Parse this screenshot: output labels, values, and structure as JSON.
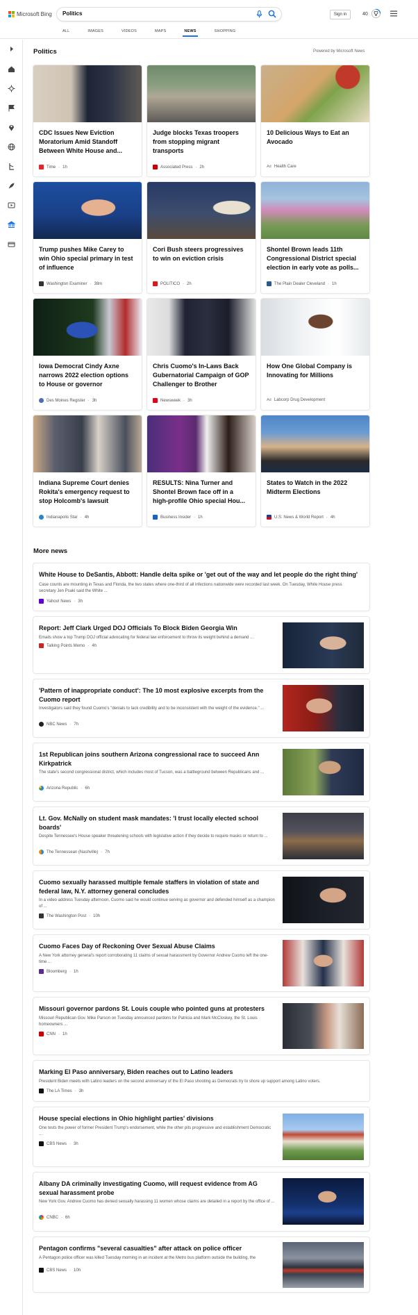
{
  "header": {
    "logo": "Microsoft Bing",
    "query": "Politics",
    "signin": "Sign in",
    "points": "40",
    "tabs": [
      "ALL",
      "IMAGES",
      "VIDEOS",
      "MAPS",
      "NEWS",
      "SHOPPING"
    ],
    "active_tab": "NEWS"
  },
  "colors": {
    "accent": "#1a73e8",
    "logo_red": "#f25022",
    "logo_green": "#7fba00",
    "logo_blue": "#00a4ef",
    "logo_yellow": "#ffb900"
  },
  "main": {
    "title": "Politics",
    "powered": "Powered by Microsoft News",
    "cards": [
      {
        "title": "CDC Issues New Eviction Moratorium Amid Standoff Between White House and...",
        "source": "Time",
        "time": "1h"
      },
      {
        "title": "Judge blocks Texas troopers from stopping migrant transports",
        "source": "Associated Press",
        "time": "2h"
      },
      {
        "title": "10 Delicious Ways to Eat an Avocado",
        "source": "Health Care",
        "time": "",
        "ad": "Ad"
      },
      {
        "title": "Trump pushes Mike Carey to win Ohio special primary in test of influence",
        "source": "Washington Examiner",
        "time": "38m"
      },
      {
        "title": "Cori Bush steers progressives to win on eviction crisis",
        "source": "POLITICO",
        "time": "2h"
      },
      {
        "title": "Shontel Brown leads 11th Congressional District special election in early vote as polls...",
        "source": "The Plain Dealer Cleveland",
        "time": "1h"
      },
      {
        "title": "Iowa Democrat Cindy Axne narrows 2022 election options to House or governor",
        "source": "Des Moines Register",
        "time": "3h"
      },
      {
        "title": "Chris Cuomo's In-Laws Back Gubernatorial Campaign of GOP Challenger to Brother",
        "source": "Newsweek",
        "time": "3h"
      },
      {
        "title": "How One Global Company is Innovating for Millions",
        "source": "Labcorp Drug Development",
        "time": "",
        "ad": "Ad"
      },
      {
        "title": "Indiana Supreme Court denies Rokita's emergency request to stop Holcomb's lawsuit",
        "source": "Indianapolis Star",
        "time": "4h"
      },
      {
        "title": "RESULTS: Nina Turner and Shontel Brown face off in a high-profile Ohio special Hou...",
        "source": "Business Insider",
        "time": "1h"
      },
      {
        "title": "States to Watch in the 2022 Midterm Elections",
        "source": "U.S. News & World Report",
        "time": "4h"
      }
    ],
    "more_title": "More news",
    "news": [
      {
        "title": "White House to DeSantis, Abbott: Handle delta spike or 'get out of the way and let people do the right thing'",
        "snippet": "Case counts are mounting in Texas and Florida, the two states where one-third of all infections nationwide were recorded last week. On Tuesday, White House press secretary Jen Psaki said the White ...",
        "source": "Yahoo! News",
        "time": "3h"
      },
      {
        "title": "Report: Jeff Clark Urged DOJ Officials To Block Biden Georgia Win",
        "snippet": "Emails show a top Trump DOJ official advocating for federal law enforcement to throw its weight behind a demand ...",
        "source": "Talking Points Memo",
        "time": "4h"
      },
      {
        "title": "'Pattern of inappropriate conduct': The 10 most explosive excerpts from the Cuomo report",
        "snippet": "Investigators said they found Cuomo's \"denials to lack credibility and to be inconsistent with the weight of the evidence.\" ...",
        "source": "NBC News",
        "time": "7h"
      },
      {
        "title": "1st Republican joins southern Arizona congressional race to succeed Ann Kirkpatrick",
        "snippet": "The state's second congressional district, which includes most of Tucson, was a battleground between Republicans and ...",
        "source": "Arizona Republic",
        "time": "6h"
      },
      {
        "title": "Lt. Gov. McNally on student mask mandates: 'I trust locally elected school boards'",
        "snippet": "Despite Tennessee's House speaker threatening schools with legislative action if they decide to require masks or return to ...",
        "source": "The Tennessean (Nashville)",
        "time": "7h"
      },
      {
        "title": "Cuomo sexually harassed multiple female staffers in violation of state and federal law, N.Y. attorney general concludes",
        "snippet": "In a video address Tuesday afternoon, Cuomo said he would continue serving as governor and defended himself as a champion of ...",
        "source": "The Washington Post",
        "time": "10h"
      },
      {
        "title": "Cuomo Faces Day of Reckoning Over Sexual Abuse Claims",
        "snippet": "A New York attorney general's report corroborating 11 claims of sexual harassment by Governor Andrew Cuomo left the one-time ...",
        "source": "Bloomberg",
        "time": "1h"
      },
      {
        "title": "Missouri governor pardons St. Louis couple who pointed guns at protesters",
        "snippet": "Missouri Republican Gov. Mike Parson on Tuesday announced pardons for Patricia and Mark McCloskey, the St. Louis homeowners ...",
        "source": "CNN",
        "time": "1h"
      },
      {
        "title": "Marking El Paso anniversary, Biden reaches out to Latino leaders",
        "snippet": "President Biden meets with Latino leaders on the second anniversary of the El Paso shooting as Democrats try to shore up support among Latino voters.",
        "source": "The LA Times",
        "time": "3h"
      },
      {
        "title": "House special elections in Ohio highlight parties' divisions",
        "snippet": "One tests the power of former President Trump's endorsement, while the other pits progressive and establishment Democratic ...",
        "source": "CBS News",
        "time": "3h"
      },
      {
        "title": "Albany DA criminally investigating Cuomo, will request evidence from AG sexual harassment probe",
        "snippet": "New York Gov. Andrew Cuomo has denied sexually harassing 11 women whose claims are detailed in a report by the office of ...",
        "source": "CNBC",
        "time": "6h"
      },
      {
        "title": "Pentagon confirms \"several casualties\" after attack on police officer",
        "snippet": "A Pentagon police officer was killed Tuesday morning in an incident at the Metro bus platform outside the building, the",
        "source": "CBS News",
        "time": "10h"
      }
    ]
  }
}
